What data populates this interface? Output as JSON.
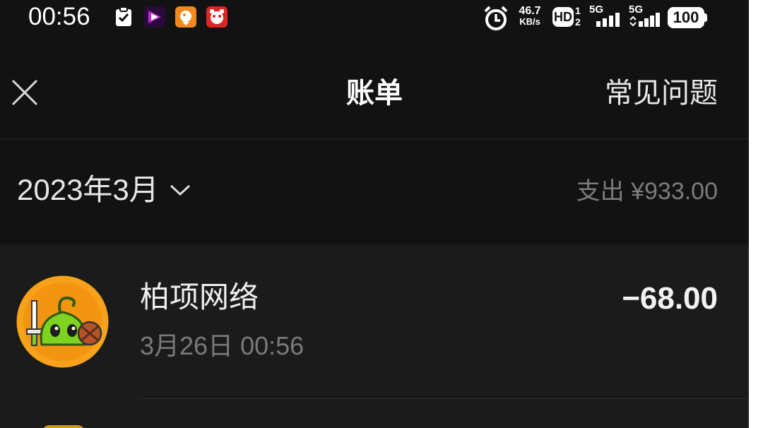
{
  "status_bar": {
    "time": "00:56",
    "notification_icons": [
      "clipboard-check-icon",
      "video-app-icon",
      "orange-app-icon",
      "red-app-icon"
    ],
    "network_speed_value": "46.7",
    "network_speed_unit": "KB/s",
    "hd_badge": "HD",
    "hd_sub_top": "1",
    "hd_sub_bottom": "2",
    "signal1_label": "5G",
    "signal2_label": "5G",
    "battery": "100"
  },
  "header": {
    "title": "账单",
    "faq": "常见问题"
  },
  "month_section": {
    "month": "2023年3月",
    "summary": "支出 ¥933.00"
  },
  "transactions": [
    {
      "merchant": "柏项网络",
      "time": "3月26日 00:56",
      "amount": "−68.00"
    }
  ],
  "colors": {
    "background": "#121212",
    "list_background": "#1b1b1b",
    "secondary_text": "#7a7a7a",
    "avatar_orange": "#f39c12",
    "avatar_green": "#7ed321"
  }
}
